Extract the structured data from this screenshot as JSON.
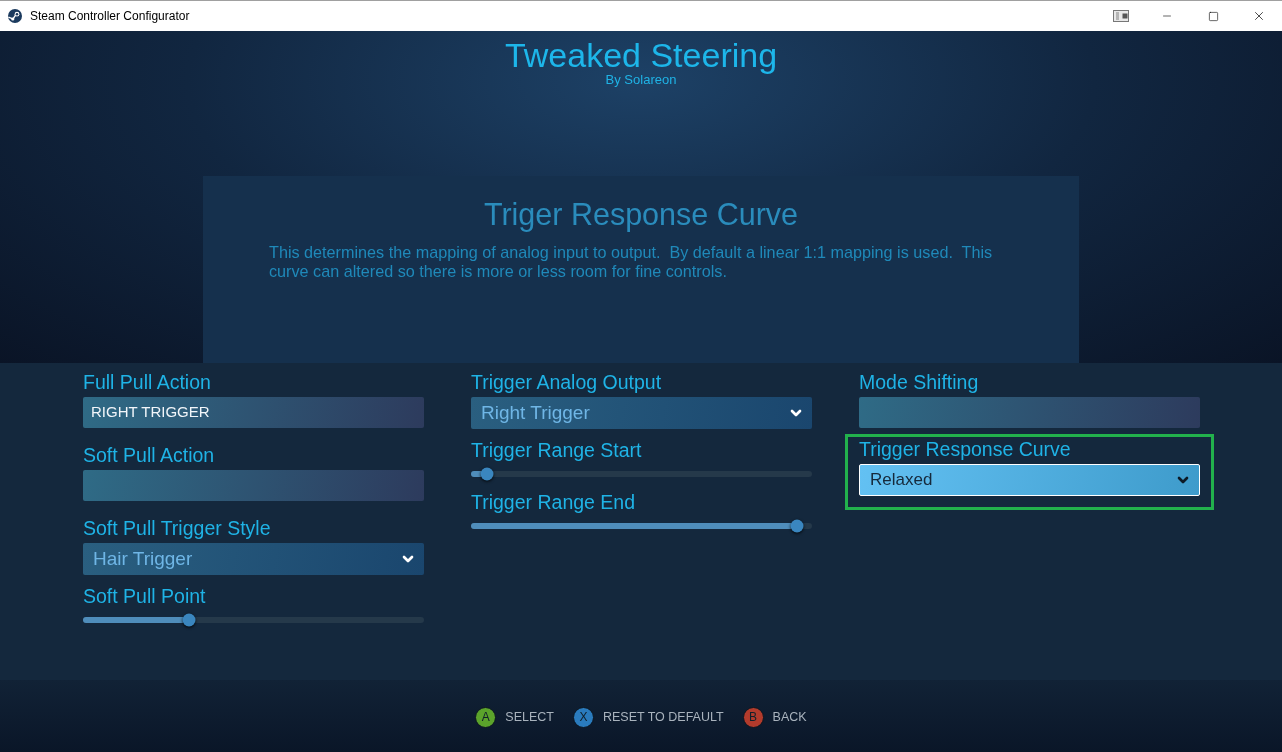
{
  "window": {
    "title": "Steam Controller Configurator"
  },
  "header": {
    "title": "Tweaked Steering",
    "author": "By Solareon"
  },
  "info_panel": {
    "title": "Triger Response Curve",
    "description": "This determines the mapping of analog input to output.  By default a linear 1:1 mapping is used.  This curve can altered so there is more or less room for fine controls."
  },
  "columns": [
    {
      "items": [
        {
          "kind": "action",
          "label": "Full Pull Action",
          "value": "RIGHT TRIGGER",
          "selected": false
        },
        {
          "kind": "action",
          "label": "Soft Pull Action",
          "selected": false
        },
        {
          "kind": "dropdown",
          "label": "Soft Pull Trigger Style",
          "value": "Hair Trigger",
          "selected": false
        },
        {
          "kind": "slider",
          "label": "Soft Pull Point",
          "level": 0.31,
          "selected": false
        }
      ]
    },
    {
      "items": [
        {
          "kind": "dropdown",
          "label": "Trigger Analog Output",
          "value": "Right Trigger",
          "selected": false
        },
        {
          "kind": "slider",
          "label": "Trigger Range Start",
          "level": 0.047,
          "selected": false
        },
        {
          "kind": "slider",
          "label": "Trigger Range End",
          "level": 0.956,
          "selected": false
        }
      ]
    },
    {
      "items": [
        {
          "kind": "action",
          "label": "Mode Shifting",
          "selected": false
        },
        {
          "kind": "dropdown",
          "label": "Trigger Response Curve",
          "value": "Relaxed",
          "selected": true
        }
      ]
    }
  ],
  "footer": {
    "hints": [
      {
        "button": "A",
        "label": "SELECT",
        "color": "#5ba32b"
      },
      {
        "button": "X",
        "label": "RESET TO DEFAULT",
        "color": "#2a7bbd"
      },
      {
        "button": "B",
        "label": "BACK",
        "color": "#b23b2c"
      }
    ]
  }
}
